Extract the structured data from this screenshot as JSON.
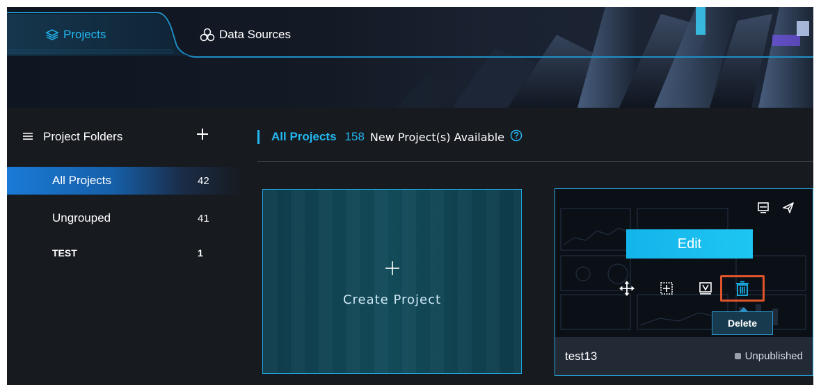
{
  "tabs": {
    "projects_label": "Projects",
    "datasources_label": "Data Sources"
  },
  "sidebar": {
    "header_label": "Project Folders",
    "items": [
      {
        "label": "All Projects",
        "count": "42"
      },
      {
        "label": "Ungrouped",
        "count": "41"
      },
      {
        "label": "TEST",
        "count": "1"
      }
    ]
  },
  "main": {
    "title": "All Projects",
    "available_count": "158",
    "available_text": "New Project(s) Available"
  },
  "create_card": {
    "label": "Create Project"
  },
  "project_card": {
    "edit_label": "Edit",
    "tooltip": "Delete",
    "name": "test13",
    "status": "Unpublished"
  },
  "colors": {
    "accent": "#23b8f1",
    "delete_highlight": "#e0542c",
    "background": "#171a1f"
  },
  "icons": [
    "layers-icon",
    "data-sources-icon",
    "menu-icon",
    "plus-icon",
    "help-icon",
    "preview-icon",
    "publish-icon",
    "move-icon",
    "copy-icon",
    "template-icon",
    "trash-icon"
  ]
}
